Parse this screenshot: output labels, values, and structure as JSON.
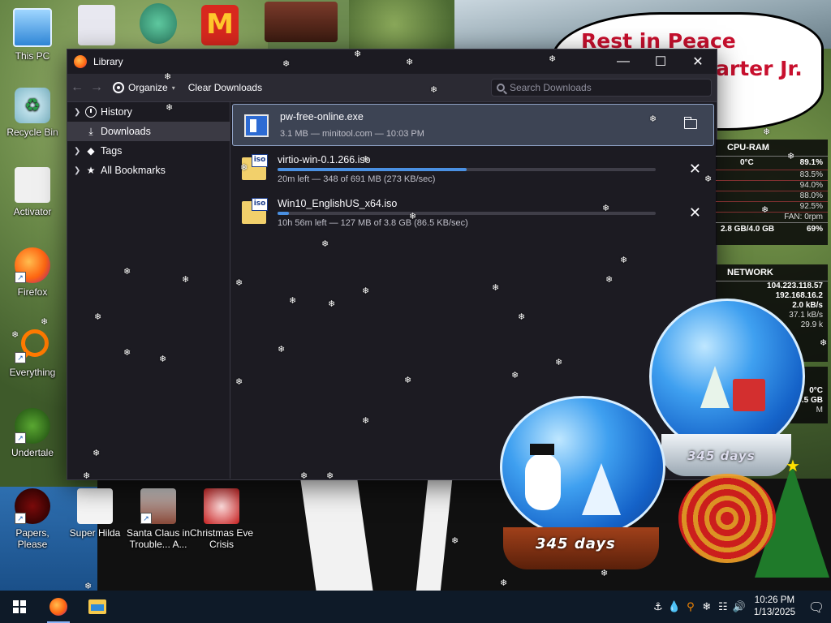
{
  "desktop": {
    "icons": [
      {
        "label": "This PC"
      },
      {
        "label": "Recycle Bin"
      },
      {
        "label": "Activator"
      },
      {
        "label": "Firefox"
      },
      {
        "label": "Everything"
      },
      {
        "label": "Undertale"
      },
      {
        "label": "Papers, Please"
      },
      {
        "label": "Super Hilda"
      },
      {
        "label": "Santa Claus in Trouble... A..."
      },
      {
        "label": "Christmas Eve Crisis"
      }
    ],
    "sign": {
      "line1": "Rest in Peace",
      "line2": "arter Jr."
    }
  },
  "library": {
    "title": "Library",
    "toolbar": {
      "organize": "Organize",
      "clear": "Clear Downloads",
      "search_placeholder": "Search Downloads"
    },
    "sidebar": [
      {
        "label": "History"
      },
      {
        "label": "Downloads"
      },
      {
        "label": "Tags"
      },
      {
        "label": "All Bookmarks"
      }
    ],
    "downloads": [
      {
        "name": "pw-free-online.exe",
        "meta": "3.1 MB — minitool.com — 10:03 PM",
        "progress": 1.0
      },
      {
        "name": "virtio-win-0.1.266.iso",
        "meta": "20m left — 348 of 691 MB (273 KB/sec)",
        "progress": 0.5
      },
      {
        "name": "Win10_EnglishUS_x64.iso",
        "meta": "10h 56m left — 127 MB of 3.8 GB (86.5 KB/sec)",
        "progress": 0.03
      }
    ]
  },
  "gadget": {
    "cpu_title": "CPU-RAM",
    "cpu_temp": "0°C",
    "cpu_total": "89.1%",
    "cores": [
      "83.5%",
      "94.0%",
      "88.0%",
      "92.5%"
    ],
    "fan": "FAN: 0rpm",
    "ram": "2.8 GB/4.0 GB",
    "ram_pct": "69%",
    "net_title": "NETWORK",
    "ip1": "104.223.118.57",
    "ip2": "192.168.16.2",
    "down": "2.0 kB/s",
    "up": "37.1 kB/s",
    "other": "29.9 k",
    "disk_temp": "0°C",
    "disk": "9.5 GB",
    "disk_m": "M"
  },
  "globes": {
    "left_days": "345 days",
    "right_days": "345 days"
  },
  "taskbar": {
    "time": "10:26 PM",
    "date": "1/13/2025"
  }
}
